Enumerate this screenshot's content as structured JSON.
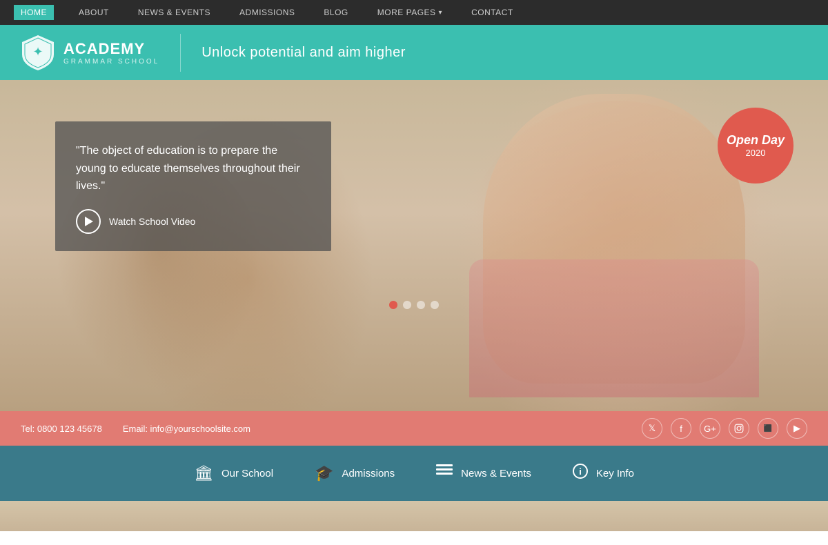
{
  "nav": {
    "items": [
      {
        "label": "HOME",
        "active": true
      },
      {
        "label": "ABOUT",
        "active": false
      },
      {
        "label": "NEWS & EVENTS",
        "active": false
      },
      {
        "label": "ADMISSIONS",
        "active": false
      },
      {
        "label": "BLOG",
        "active": false
      },
      {
        "label": "MORE PAGES",
        "active": false,
        "hasDropdown": true
      },
      {
        "label": "CONTACT",
        "active": false
      }
    ]
  },
  "header": {
    "school_name": "ACADEMY",
    "school_sub": "GRAMMAR SCHOOL",
    "tagline": "Unlock potential and aim higher"
  },
  "hero": {
    "quote": "\"The object of education is to prepare the young to educate themselves throughout their lives.\"",
    "watch_video_label": "Watch School Video",
    "open_day_line1": "Open Day",
    "open_day_line2": "2020"
  },
  "contact_bar": {
    "tel_label": "Tel: 0800 123 45678",
    "email_label": "Email: info@yourschoolsite.com"
  },
  "social_icons": [
    {
      "name": "twitter",
      "symbol": "𝕋"
    },
    {
      "name": "facebook",
      "symbol": "f"
    },
    {
      "name": "google-plus",
      "symbol": "G+"
    },
    {
      "name": "instagram",
      "symbol": "📷"
    },
    {
      "name": "flickr",
      "symbol": "⬛"
    },
    {
      "name": "youtube",
      "symbol": "▶"
    }
  ],
  "quick_links": [
    {
      "label": "Our School",
      "icon": "🏛"
    },
    {
      "label": "Admissions",
      "icon": "🎓"
    },
    {
      "label": "News & Events",
      "icon": "☰"
    },
    {
      "label": "Key Info",
      "icon": "ℹ"
    }
  ],
  "dots": [
    {
      "active": true
    },
    {
      "active": false
    },
    {
      "active": false
    },
    {
      "active": false
    }
  ]
}
